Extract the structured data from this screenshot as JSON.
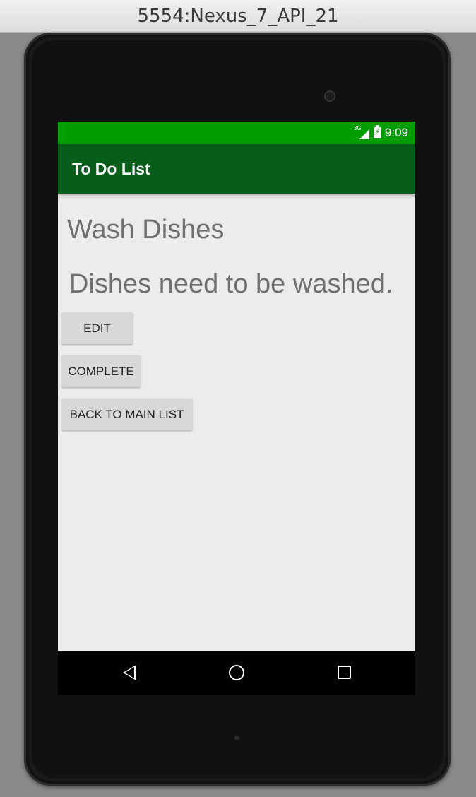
{
  "window": {
    "title": "5554:Nexus_7_API_21"
  },
  "status_bar": {
    "signal_label": "3G",
    "time": "9:09"
  },
  "app_bar": {
    "title": "To Do List"
  },
  "item": {
    "title": "Wash Dishes",
    "description": "Dishes need to be washed."
  },
  "buttons": {
    "edit": "EDIT",
    "complete": "COMPLETE",
    "back": "BACK TO MAIN LIST"
  },
  "nav_bar": {
    "back_icon": "back-triangle-icon",
    "home_icon": "home-circle-icon",
    "recent_icon": "recent-apps-square-icon"
  },
  "colors": {
    "status_bar": "#009e00",
    "app_bar": "#075e1b",
    "screen_background": "#ececec",
    "button_background": "#d8d8d8"
  }
}
